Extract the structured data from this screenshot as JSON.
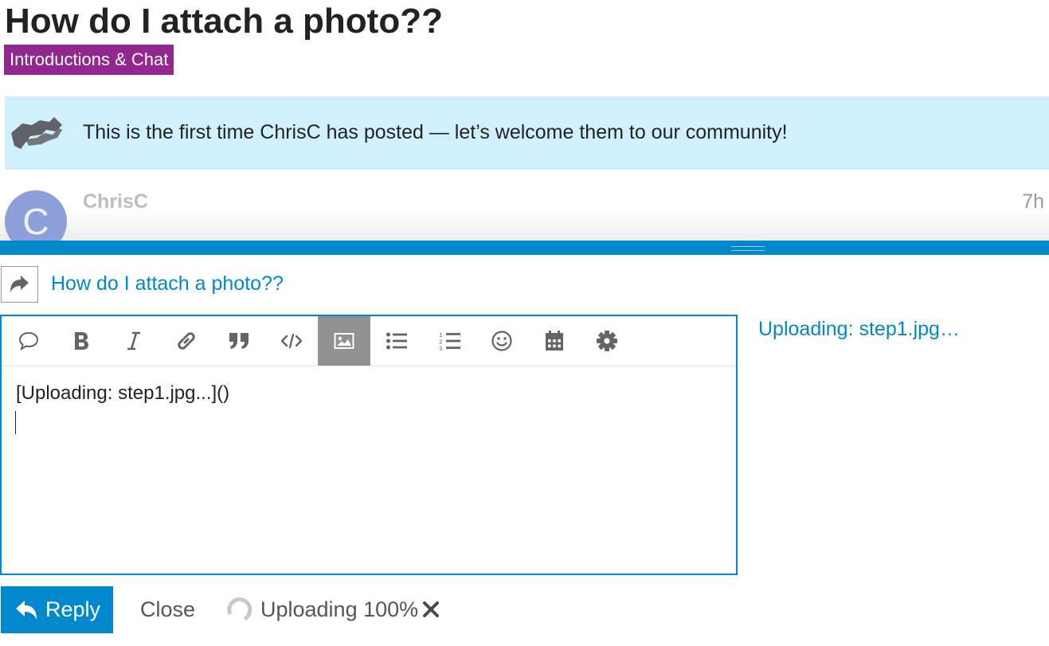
{
  "colors": {
    "accent": "#0088cc",
    "category": "#92278f",
    "notice_bg": "#d1f0ff",
    "avatar": "#8c9fd9",
    "toolbar_active_bg": "#919191",
    "icon": "#646464"
  },
  "topic": {
    "title": "How do I attach a photo??",
    "category": "Introductions & Chat"
  },
  "notice": {
    "icon": "handshake-icon",
    "text": "This is the first time ChrisC has posted — let’s welcome them to our community!"
  },
  "post": {
    "avatar_letter": "C",
    "author": "ChrisC",
    "age": "7h"
  },
  "composer": {
    "action_icon": "share-icon",
    "reply_to_title": "How do I attach a photo??",
    "toolbar": [
      {
        "name": "quote-icon",
        "active": false
      },
      {
        "name": "bold-icon",
        "active": false
      },
      {
        "name": "italic-icon",
        "active": false
      },
      {
        "name": "link-icon",
        "active": false
      },
      {
        "name": "blockquote-icon",
        "active": false
      },
      {
        "name": "code-icon",
        "active": false
      },
      {
        "name": "upload-image-icon",
        "active": true
      },
      {
        "name": "bullet-list-icon",
        "active": false
      },
      {
        "name": "numbered-list-icon",
        "active": false
      },
      {
        "name": "emoji-icon",
        "active": false
      },
      {
        "name": "calendar-icon",
        "active": false
      },
      {
        "name": "gear-icon",
        "active": false
      }
    ],
    "editor_text": "[Uploading: step1.jpg...]()",
    "preview_text": "Uploading: step1.jpg…"
  },
  "footer": {
    "reply_label": "Reply",
    "close_label": "Close",
    "upload_status": "Uploading 100%",
    "upload_progress": 100
  }
}
